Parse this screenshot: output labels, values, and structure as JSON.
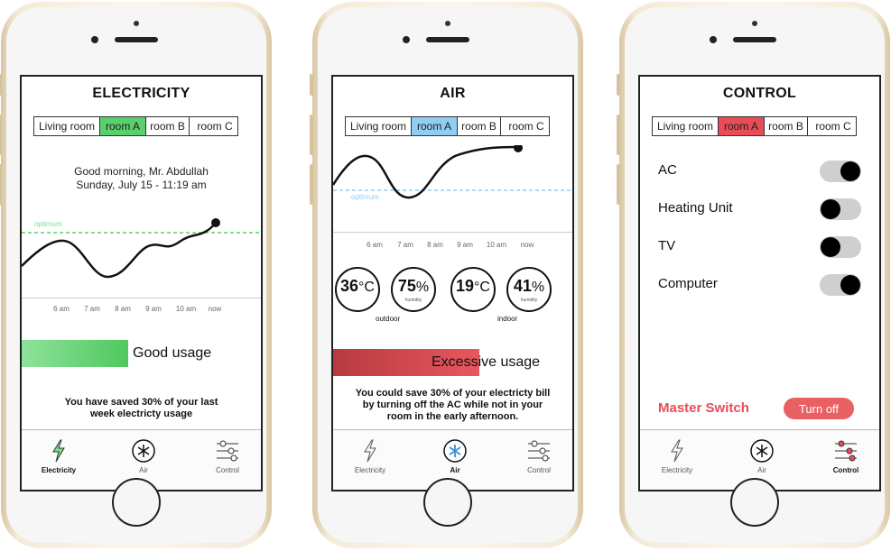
{
  "colors": {
    "electricity_accent": "#5ad06c",
    "air_accent": "#8fcdf2",
    "control_accent": "#e84c57"
  },
  "tabs": [
    "Living room",
    "room A",
    "room B",
    "room C"
  ],
  "nav": {
    "electricity": "Electricity",
    "air": "Air",
    "control": "Control"
  },
  "axis_ticks": [
    "6 am",
    "7 am",
    "8 am",
    "9 am",
    "10 am",
    "now"
  ],
  "electricity": {
    "title": "ELECTRICITY",
    "greeting_line1": "Good morning, Mr. Abdullah",
    "greeting_line2": "Sunday, July 15 - 11:19 am",
    "optimum_label": "optimum",
    "usage_label": "Good usage",
    "note_line1": "You have saved 30% of your last",
    "note_line2": "week electricty usage"
  },
  "air": {
    "title": "AIR",
    "optimum_label": "optimum",
    "outdoor_temp": "36",
    "outdoor_humidity": "75",
    "indoor_temp": "19",
    "indoor_humidity": "41",
    "temp_unit": "°C",
    "humidity_unit": "%",
    "humidity_label": "humidity",
    "outdoor_label": "outdoor",
    "indoor_label": "indoor",
    "usage_label": "Excessive usage",
    "note_line1": "You could save 30% of your electricty bill",
    "note_line2": "by turning off the AC while not in your",
    "note_line3": "room in the early afternoon."
  },
  "control": {
    "title": "CONTROL",
    "devices": [
      {
        "label": "AC",
        "on": true
      },
      {
        "label": "Heating Unit",
        "on": false
      },
      {
        "label": "TV",
        "on": false
      },
      {
        "label": "Computer",
        "on": true
      }
    ],
    "master_label": "Master Switch",
    "turn_off_label": "Turn off"
  }
}
